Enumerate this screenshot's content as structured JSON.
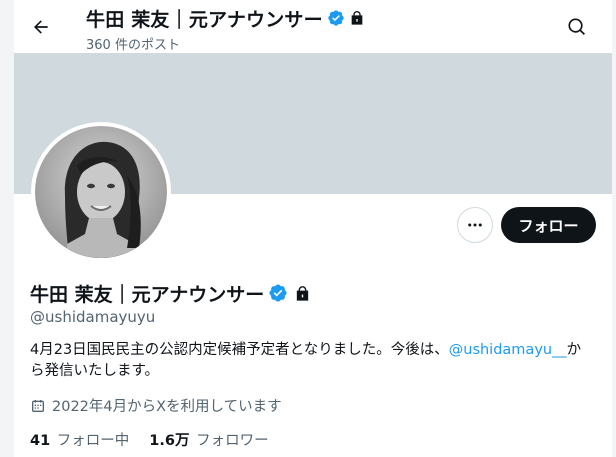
{
  "header": {
    "title": "牛田 茉友｜元アナウンサー",
    "post_count": "360 件のポスト"
  },
  "profile": {
    "display_name": "牛田 茉友｜元アナウンサー",
    "handle": "@ushidamayuyu",
    "bio_prefix": "4月23日国民民主の公認内定候補予定者となりました。今後は、",
    "bio_link": "@ushidamayu__",
    "bio_suffix": "から発信いたします。",
    "joined": "2022年4月からXを利用しています"
  },
  "actions": {
    "follow_label": "フォロー"
  },
  "stats": {
    "following_count": "41",
    "following_label": "フォロー中",
    "followers_count": "1.6万",
    "followers_label": "フォロワー"
  },
  "icons": {
    "back": "arrow-left-icon",
    "search": "search-icon",
    "verified": "verified-badge-icon",
    "lock": "lock-icon",
    "more": "more-horizontal-icon",
    "calendar": "calendar-icon"
  },
  "colors": {
    "accent": "#1d9bf0",
    "banner": "#cfd9de",
    "follow_button": "#0f1419"
  }
}
